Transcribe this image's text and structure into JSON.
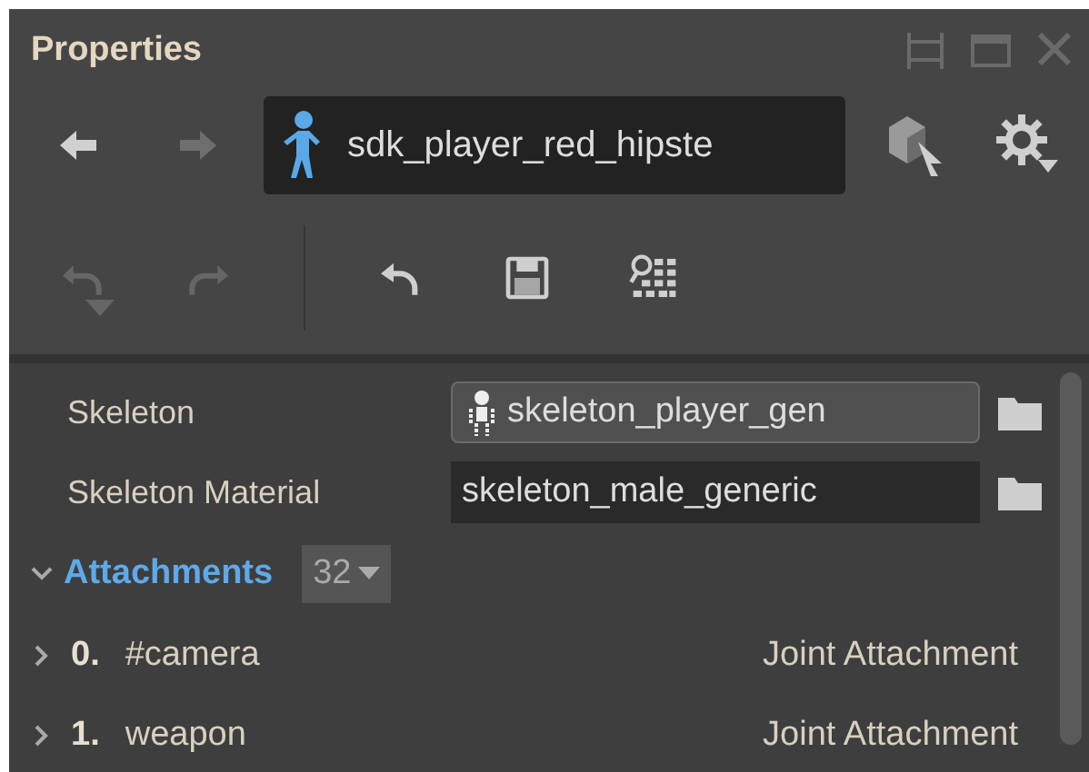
{
  "window": {
    "title": "Properties"
  },
  "nav": {
    "back": {
      "disabled": false
    },
    "forward": {
      "disabled": true
    },
    "asset": "sdk_player_red_hipste"
  },
  "toolbar": [
    {
      "kind": "undo",
      "disabled": true
    },
    {
      "kind": "redo",
      "disabled": true
    },
    {
      "kind": "revert",
      "disabled": false
    },
    {
      "kind": "save",
      "disabled": false
    },
    {
      "kind": "find",
      "disabled": false
    }
  ],
  "properties": [
    {
      "label": "Skeleton",
      "kind": "asset",
      "value": "skeleton_player_gen"
    },
    {
      "label": "Skeleton Material",
      "kind": "text",
      "value": "skeleton_male_generic"
    }
  ],
  "attachments": {
    "label": "Attachments",
    "expanded": true,
    "count": "32",
    "items": [
      {
        "index": "0.",
        "name": "#camera",
        "type": "Joint Attachment",
        "expanded": false
      },
      {
        "index": "1.",
        "name": "weapon",
        "type": "Joint Attachment",
        "expanded": false
      }
    ]
  }
}
